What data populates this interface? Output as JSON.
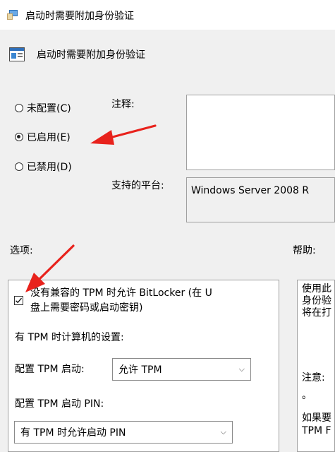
{
  "window": {
    "title": "启动时需要附加身份验证"
  },
  "header": {
    "title": "启动时需要附加身份验证"
  },
  "state_options": {
    "not_configured": "未配置(C)",
    "enabled": "已启用(E)",
    "disabled": "已禁用(D)",
    "selected": "enabled"
  },
  "comment": {
    "label": "注释:",
    "value": ""
  },
  "platform": {
    "label": "支持的平台:",
    "value": "Windows Server 2008 R"
  },
  "options": {
    "label": "选项:",
    "allow_bitlocker_line1": "没有兼容的 TPM 时允许 BitLocker (在 U",
    "allow_bitlocker_line2": "盘上需要密码或启动密钥)",
    "allow_bitlocker_checked": true,
    "tpm_settings_label": "有 TPM 时计算机的设置:",
    "tpm_startup_label": "配置 TPM 启动:",
    "tpm_startup_value": "允许 TPM",
    "tpm_pin_label": "配置 TPM 启动 PIN:",
    "tpm_pin_value": "有 TPM 时允许启动 PIN"
  },
  "help": {
    "label": "帮助:",
    "lines": [
      "使用此",
      "身份验",
      "将在打",
      "",
      "注意:",
      "。",
      "",
      "如果要",
      "TPM F"
    ]
  },
  "annotations": {
    "arrow_color": "#e8221c"
  }
}
